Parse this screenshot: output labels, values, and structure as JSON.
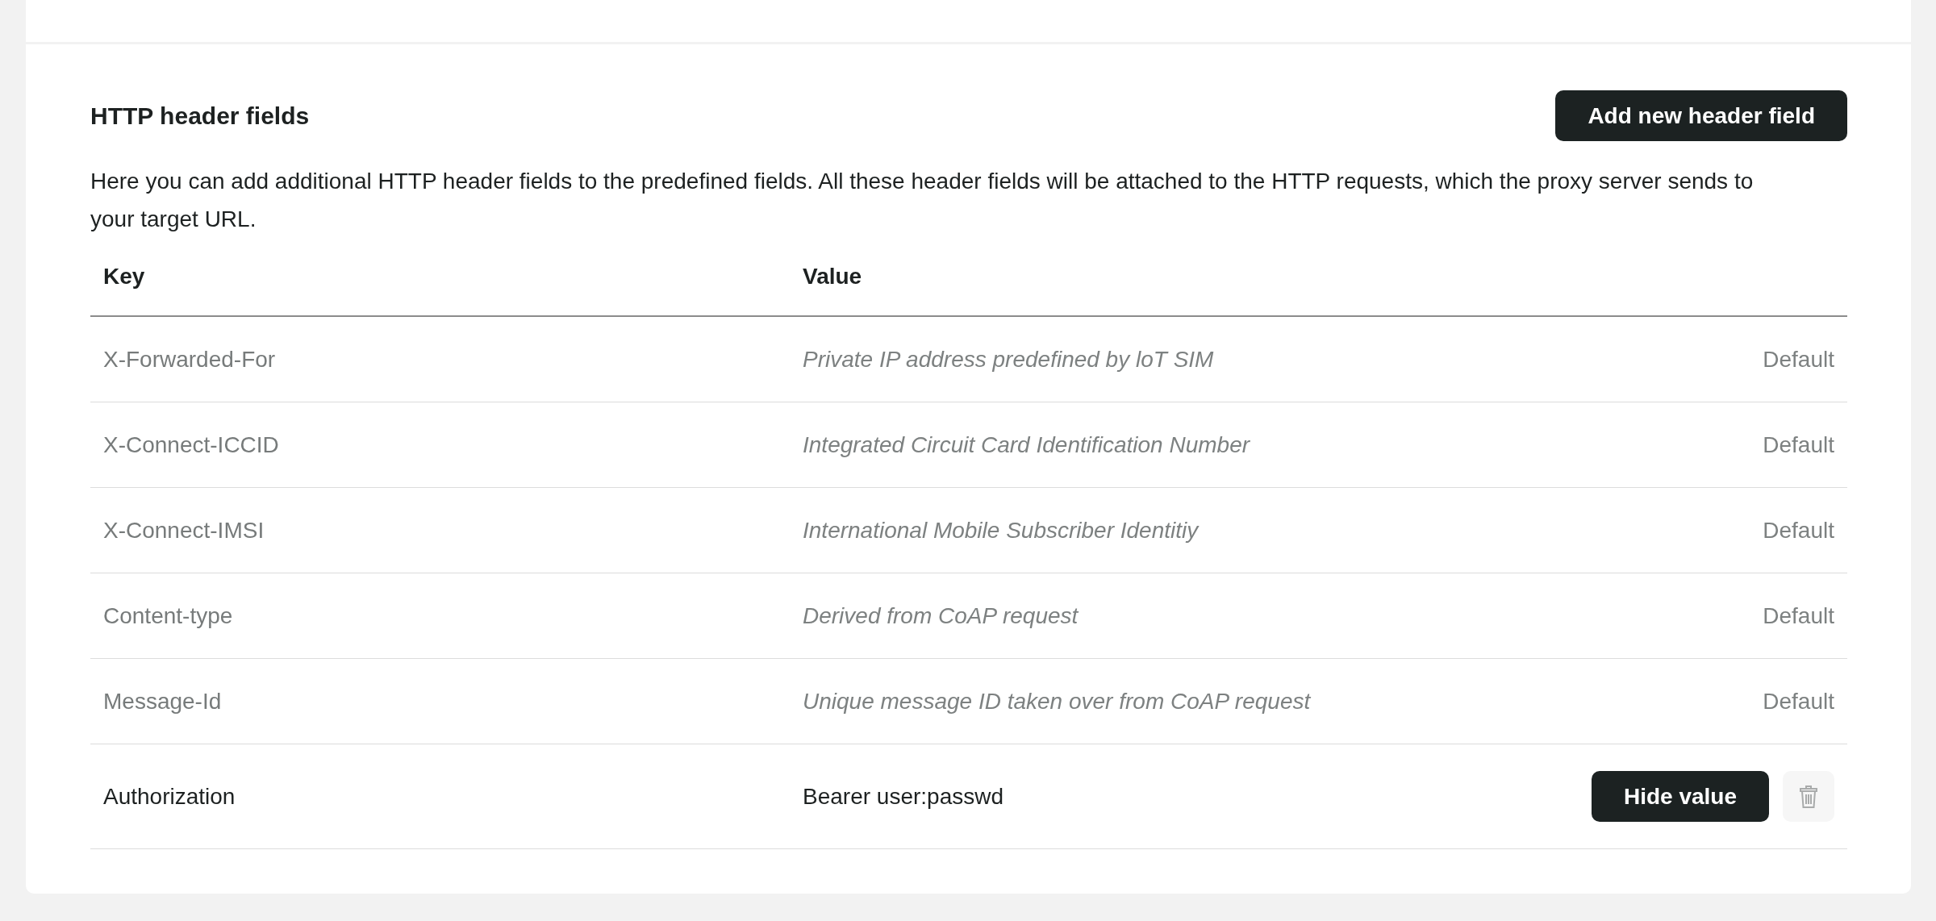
{
  "header_fields": {
    "title": "HTTP header fields",
    "add_button": "Add new header field",
    "description": "Here you can add additional HTTP header fields to the predefined fields. All these header fields will be attached to the HTTP requests, which the proxy server sends to your target URL.",
    "columns": [
      "Key",
      "Value"
    ],
    "rows": [
      {
        "kind": "default",
        "key": "X-Forwarded-For",
        "value": "Private IP address predefined by loT SIM",
        "status": "Default"
      },
      {
        "kind": "default",
        "key": "X-Connect-ICCID",
        "value": "Integrated Circuit Card Identification Number",
        "status": "Default"
      },
      {
        "kind": "default",
        "key": "X-Connect-IMSI",
        "value": "International Mobile Subscriber Identitiy",
        "status": "Default"
      },
      {
        "kind": "default",
        "key": "Content-type",
        "value": "Derived from CoAP request",
        "status": "Default"
      },
      {
        "kind": "default",
        "key": "Message-Id",
        "value": "Unique message ID taken over from CoAP request",
        "status": "Default"
      },
      {
        "kind": "custom",
        "key": "Authorization",
        "value": "Bearer user:passwd",
        "toggle_button": "Hide value"
      }
    ]
  }
}
